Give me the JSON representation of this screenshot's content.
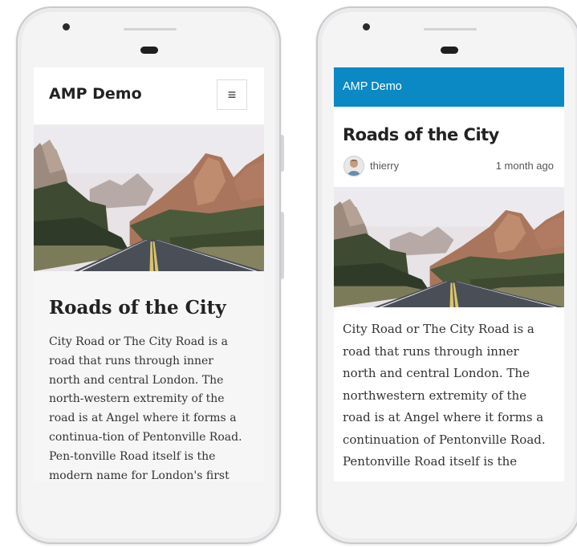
{
  "left_phone": {
    "site_title": "AMP Demo",
    "menu_icon": "hamburger-menu-icon",
    "article": {
      "title": "Roads of the City",
      "body": "City Road or The City Road is a road that runs through inner north and central London. The north-western extremity of the road is at Angel where it forms a continua-tion of Pentonville Road. Pen-tonville Road itself is the modern name for London's first bypass, the"
    }
  },
  "right_phone": {
    "site_title": "AMP Demo",
    "header_color": "#0a89c5",
    "article": {
      "title": "Roads of the City",
      "author": "thierry",
      "date": "1 month ago",
      "body": "City Road or The City Road is a road that runs through inner north and central London. The northwestern extremity of the road is at Angel where it forms a continuation of Pentonville Road. Pentonville Road itself is the"
    }
  }
}
